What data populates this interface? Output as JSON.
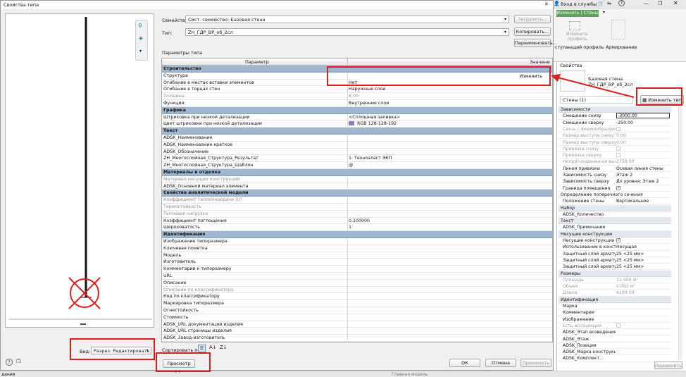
{
  "dialog": {
    "title": "Свойства типа",
    "family_label": "Семейство:",
    "family_value": "Сист. семейство: Базовая стена",
    "type_label": "Тип:",
    "type_value": "ZH_ГДР_ВР_об_2сл",
    "load_button": "Загрузить...",
    "copy_button": "Копировать...",
    "rename_button": "Переименовать...",
    "type_params_label": "Параметры типа",
    "col_param": "Параметр",
    "col_value": "Значени",
    "view_label": "Вид:",
    "view_value": "Разрез: Редактировать атри",
    "sort_label": "Сортировать по:",
    "preview_button": "Просмотр >>",
    "ok_button": "ОК",
    "cancel_button": "Отмена",
    "apply_button": "Применить",
    "edit_label": "Изменить",
    "rows": [
      {
        "kind": "group",
        "label": "Строительство"
      },
      {
        "label": "Структура",
        "value": ""
      },
      {
        "label": "Огибание в местах вставки элементов",
        "value": "Нет"
      },
      {
        "label": "Огибание в торцах стен",
        "value": "Наружные слои"
      },
      {
        "label": "Толщина",
        "value": "8.00",
        "gray": true
      },
      {
        "label": "Функция",
        "value": "Внутренние слои"
      },
      {
        "kind": "group",
        "label": "Графика"
      },
      {
        "label": "Штриховка при низкой детализации",
        "value": "<Сплошная заливка>"
      },
      {
        "label": "Цвет штриховки при низкой детализации",
        "value": "RGB 128-128-192",
        "swatch": "#8080c0"
      },
      {
        "kind": "group",
        "label": "Текст"
      },
      {
        "label": "ADSK_Наименование",
        "value": ""
      },
      {
        "label": "ADSK_Наименование краткое",
        "value": ""
      },
      {
        "label": "ADSK_Обозначение",
        "value": ""
      },
      {
        "label": "ZH_Многослойная_Структура_Результат",
        "value": "1. Техноэласт ЭКП"
      },
      {
        "label": "ZH_Многослойная_Структура_Шаблон",
        "value": "@"
      },
      {
        "kind": "group",
        "label": "Материалы и отделка"
      },
      {
        "label": "Материал несущих конструкций",
        "value": "",
        "gray": true
      },
      {
        "label": "ADSK_Основной материал элемента",
        "value": ""
      },
      {
        "kind": "group",
        "label": "Свойства аналитической модели"
      },
      {
        "label": "Коэффициент теплопередачи (U)",
        "value": "",
        "gray": true
      },
      {
        "label": "Термостойкость",
        "value": "",
        "gray": true
      },
      {
        "label": "Тепловая нагрузка",
        "value": "",
        "gray": true
      },
      {
        "label": "Коэффициент поглощения",
        "value": "0.100000"
      },
      {
        "label": "Шероховатость",
        "value": "1"
      },
      {
        "kind": "group",
        "label": "Идентификация"
      },
      {
        "label": "Изображение типоразмера",
        "value": ""
      },
      {
        "label": "Ключевая пометка",
        "value": ""
      },
      {
        "label": "Модель",
        "value": ""
      },
      {
        "label": "Изготовитель",
        "value": ""
      },
      {
        "label": "Комментарии к типоразмеру",
        "value": ""
      },
      {
        "label": "URL",
        "value": ""
      },
      {
        "label": "Описание",
        "value": ""
      },
      {
        "label": "Описание по классификатору",
        "value": "",
        "gray": true
      },
      {
        "label": "Код по классификатору",
        "value": ""
      },
      {
        "label": "Маркировка типоразмера",
        "value": ""
      },
      {
        "label": "Огнестойкость",
        "value": ""
      },
      {
        "label": "Стоимость",
        "value": ""
      },
      {
        "label": "ADSK_URL документации изделия",
        "value": ""
      },
      {
        "label": "ADSK_URL страницы изделия",
        "value": ""
      },
      {
        "label": "ADSK_Завод-изготовитель",
        "value": ""
      }
    ]
  },
  "topbar": {
    "signin": "Вход в службы",
    "help": "?"
  },
  "ribbon": {
    "context_tab": "Изменить | Стены",
    "edit_profile_top": "Изменить",
    "edit_profile_bottom": "профиль",
    "left_label": "ступающий профиль",
    "reinforce_label": "Армирование"
  },
  "properties": {
    "title": "Свойства",
    "type_name_line1": "Базовая стена",
    "type_name_line2": "ZH_ГДР_ВР_об_2сл",
    "selector": "Стены (1)",
    "edit_type_button": "Изменить тип",
    "apply_button": "Применить",
    "rows": [
      {
        "kind": "hdr",
        "label": "Зависимости"
      },
      {
        "label": "Смещение снизу",
        "value": "-3000.00",
        "box": true
      },
      {
        "label": "Смещение сверху",
        "value": "-250.00"
      },
      {
        "label": "Связь с формообразую...",
        "value": "",
        "cb": "dis",
        "gray": true
      },
      {
        "label": "Размер выступа снизу",
        "value": "0.00",
        "gray": true
      },
      {
        "label": "Размер выступа сверху",
        "value": "0.00",
        "gray": true
      },
      {
        "label": "Привязка снизу",
        "value": "",
        "cb": "dis",
        "gray": true
      },
      {
        "label": "Привязка сверху",
        "value": "",
        "cb": "dis",
        "gray": true
      },
      {
        "label": "Неприсоединенная выс...",
        "value": "2750.00",
        "gray": true
      },
      {
        "label": "Линия привязки",
        "value": "Осевая линия стены"
      },
      {
        "label": "Зависимость снизу",
        "value": "Этаж 2"
      },
      {
        "label": "Зависимость сверху",
        "value": "До уровня: Этаж 2"
      },
      {
        "label": "Граница помещения",
        "value": "",
        "cb": "on"
      },
      {
        "label": "Определение поперечного сечения",
        "value": "",
        "sub": true
      },
      {
        "label": "Положение стены",
        "value": "Вертикальное"
      },
      {
        "kind": "hdr",
        "label": "Набор"
      },
      {
        "label": "ADSK_Количество",
        "value": ""
      },
      {
        "kind": "hdr",
        "label": "Текст"
      },
      {
        "label": "ADSK_Примечание",
        "value": ""
      },
      {
        "kind": "hdr",
        "label": "Несущие конструкции"
      },
      {
        "label": "Несущие конструкции",
        "value": "",
        "cb": "on"
      },
      {
        "label": "Использование в конст...",
        "value": "Несущая"
      },
      {
        "label": "Защитный слой армату...",
        "value": "25 <25 мм>"
      },
      {
        "label": "Защитный слой армату...",
        "value": "25 <25 мм>"
      },
      {
        "label": "Защитный слой армату...",
        "value": "25 <25 мм>"
      },
      {
        "kind": "hdr",
        "label": "Размеры"
      },
      {
        "label": "Площадь",
        "value": "11.550 м²",
        "gray": true
      },
      {
        "label": "Объем",
        "value": "0.092 м³",
        "gray": true
      },
      {
        "label": "Длина",
        "value": "4200.00",
        "gray": true
      },
      {
        "kind": "hdr",
        "label": "Идентификация"
      },
      {
        "label": "Марка",
        "value": ""
      },
      {
        "label": "Комментарии",
        "value": ""
      },
      {
        "label": "Изображение",
        "value": ""
      },
      {
        "label": "Есть ассоциация",
        "value": "",
        "cb": "dis",
        "gray": true
      },
      {
        "label": "ADSK_Этап возведения",
        "value": ""
      },
      {
        "label": "ADSK_Этаж",
        "value": ""
      },
      {
        "label": "ADSK_Позиция",
        "value": ""
      },
      {
        "label": "ADSK_Марка конструкции",
        "value": ""
      },
      {
        "label": "ADSK_Комплект...",
        "value": ""
      }
    ]
  },
  "statusbar": {
    "left": "дания",
    "model": "Главная модель"
  }
}
